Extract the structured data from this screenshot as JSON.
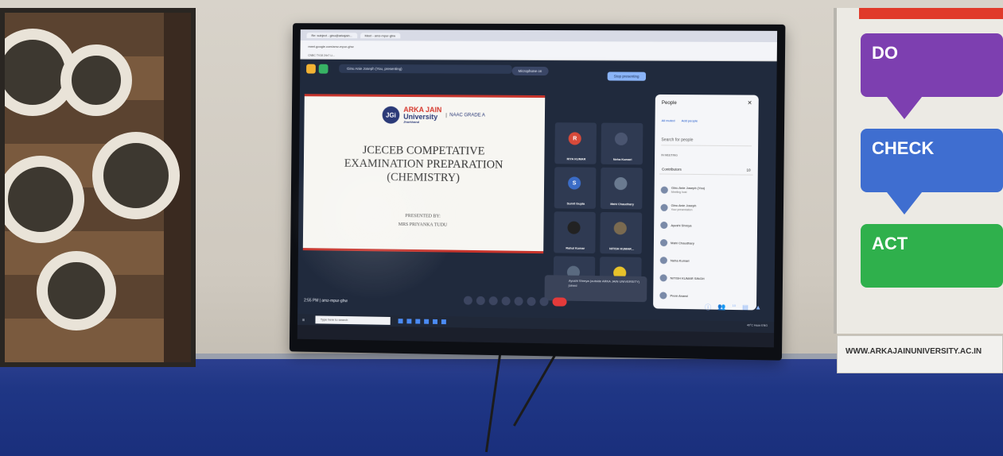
{
  "browser": {
    "tab_1": "Re: subject - ginu@arkajain...",
    "tab_2": "Meet - amz-mpur-ghw",
    "url": "meet.google.com/amz-mpur-ghw",
    "bookmark": "CNBC TV18 24x7 Li..."
  },
  "meet": {
    "presenting_label": "Ginu Anie Joseph (You, presenting)",
    "mic_label": "Microphone on",
    "stop_label": "Stop presenting",
    "time": "2:55 PM",
    "meeting_code": "amz-mpur-ghw",
    "people_count": "10"
  },
  "slide": {
    "university_line1": "ARKA JAIN",
    "university_line2": "University",
    "university_place": "Jharkhand",
    "naac": "NAAC GRADE A",
    "logo": "JGi",
    "title_line1": "JCECEB COMPETATIVE",
    "title_line2": "EXAMINATION PREPARATION",
    "title_line3": "(CHEMISTRY)",
    "presented_by": "PRESENTED BY:",
    "presenter": "MRS PRIYANKA TUDU"
  },
  "tiles": [
    {
      "name": "RIYA KUMAR",
      "initial": "R",
      "color": "#d84a3a"
    },
    {
      "name": "Neha Kumari",
      "initial": "",
      "color": "#4a5570"
    },
    {
      "name": "Sumit Gupta",
      "initial": "S",
      "color": "#3b6cc6"
    },
    {
      "name": "Mahi Chaudhary",
      "initial": "",
      "color": "#6a7a90"
    },
    {
      "name": "Rahul Kumar",
      "initial": "",
      "color": "#222"
    },
    {
      "name": "NITISH KUMAR...",
      "initial": "",
      "color": "#7a6a50"
    },
    {
      "name": "",
      "initial": "",
      "color": "#5a6a80"
    },
    {
      "name": "",
      "initial": "",
      "color": "#e7c22a"
    }
  ],
  "toast": {
    "text": "Ayushi Shreya (outside ARKA JAIN UNIVERSITY) joined"
  },
  "people": {
    "title": "People",
    "mute_all": "All muted",
    "add_people": "Add people",
    "search": "Search for people",
    "section": "IN MEETING",
    "contributors": "Contributors",
    "count": "10",
    "list": [
      {
        "name": "Ginu Anie Joseph (You)",
        "sub": "Meeting host"
      },
      {
        "name": "Ginu Anie Joseph",
        "sub": "Your presentation"
      },
      {
        "name": "Ayushi Shreya",
        "sub": ""
      },
      {
        "name": "Mahi Chaudhary",
        "sub": ""
      },
      {
        "name": "Neha Kumari",
        "sub": ""
      },
      {
        "name": "NITISH KUMAR SINGH",
        "sub": ""
      },
      {
        "name": "Prem Anand",
        "sub": ""
      }
    ]
  },
  "taskbar": {
    "search": "Type here to search",
    "weather": "40°C Haze",
    "lang": "ENG"
  },
  "wall": {
    "do": "DO",
    "check": "CHECK",
    "act": "ACT",
    "url": "WWW.ARKAJAINUNIVERSITY.AC.IN"
  }
}
